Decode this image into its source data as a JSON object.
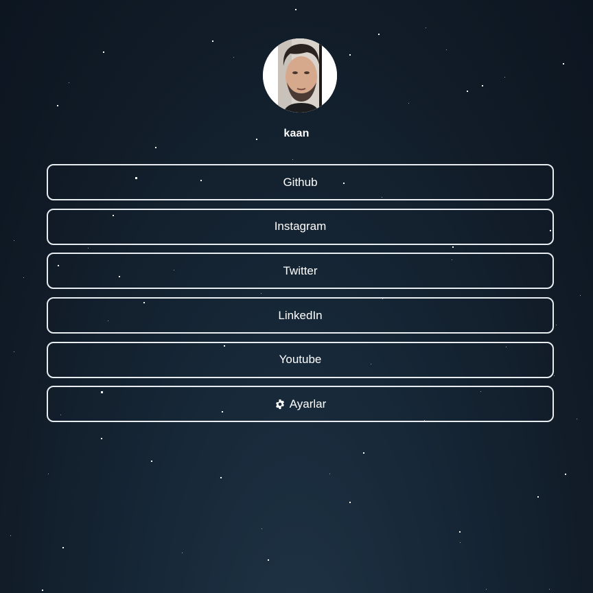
{
  "profile": {
    "username": "kaan",
    "avatar_icon": "profile-photo"
  },
  "links": [
    {
      "label": "Github"
    },
    {
      "label": "Instagram"
    },
    {
      "label": "Twitter"
    },
    {
      "label": "LinkedIn"
    },
    {
      "label": "Youtube"
    }
  ],
  "settings": {
    "label": "Ayarlar",
    "icon": "gear-icon"
  },
  "colors": {
    "background_top": "#0c1520",
    "background_bottom": "#1f3446",
    "button_border": "#e8edf2",
    "text": "#ffffff"
  }
}
